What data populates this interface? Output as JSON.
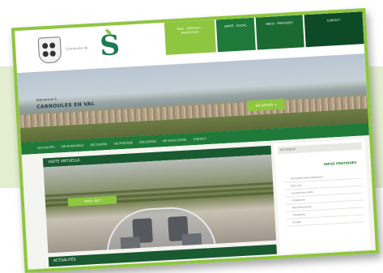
{
  "nav": {
    "tabs": [
      {
        "label": "ÉLUS · SERVICES · MUNICIPAUX"
      },
      {
        "label": "SANTÉ · SOCIAL"
      },
      {
        "label": "INFOS · PRATIQUES"
      },
      {
        "label": "CONTACT"
      }
    ]
  },
  "brand": {
    "text": "Commune de",
    "logo_letter": "S"
  },
  "hero": {
    "kicker": "Bienvenue à",
    "title": "CARNOULES EN VAL",
    "button_label": "EN SAVOIR +"
  },
  "menu": {
    "items": [
      {
        "label": "ACTUALITÉS"
      },
      {
        "label": "VIE MUNICIPALE"
      },
      {
        "label": "DÉCOUVRIR"
      },
      {
        "label": "VIE PRATIQUE"
      },
      {
        "label": "ÉDUCATION"
      },
      {
        "label": "VIE ASSOCIATIVE"
      },
      {
        "label": "CONTACT"
      }
    ]
  },
  "main": {
    "video_header": "VISITE VIRTUELLE",
    "video_label": "VIDÉO 360°",
    "news_header": "ACTUALITÉS"
  },
  "sidebar": {
    "head": "RECHERCHE",
    "title": "INFOS PRATIQUES",
    "items": [
      {
        "label": "Formalités administratives"
      },
      {
        "label": "État civil"
      },
      {
        "label": "Location de salles"
      },
      {
        "label": "Urbanisme"
      },
      {
        "label": "Marchés publics"
      },
      {
        "label": "Transports"
      },
      {
        "label": "Emploi"
      }
    ]
  },
  "colors": {
    "accent": "#8ec63f",
    "primary": "#1f7a3a",
    "dark": "#0f4a26"
  }
}
